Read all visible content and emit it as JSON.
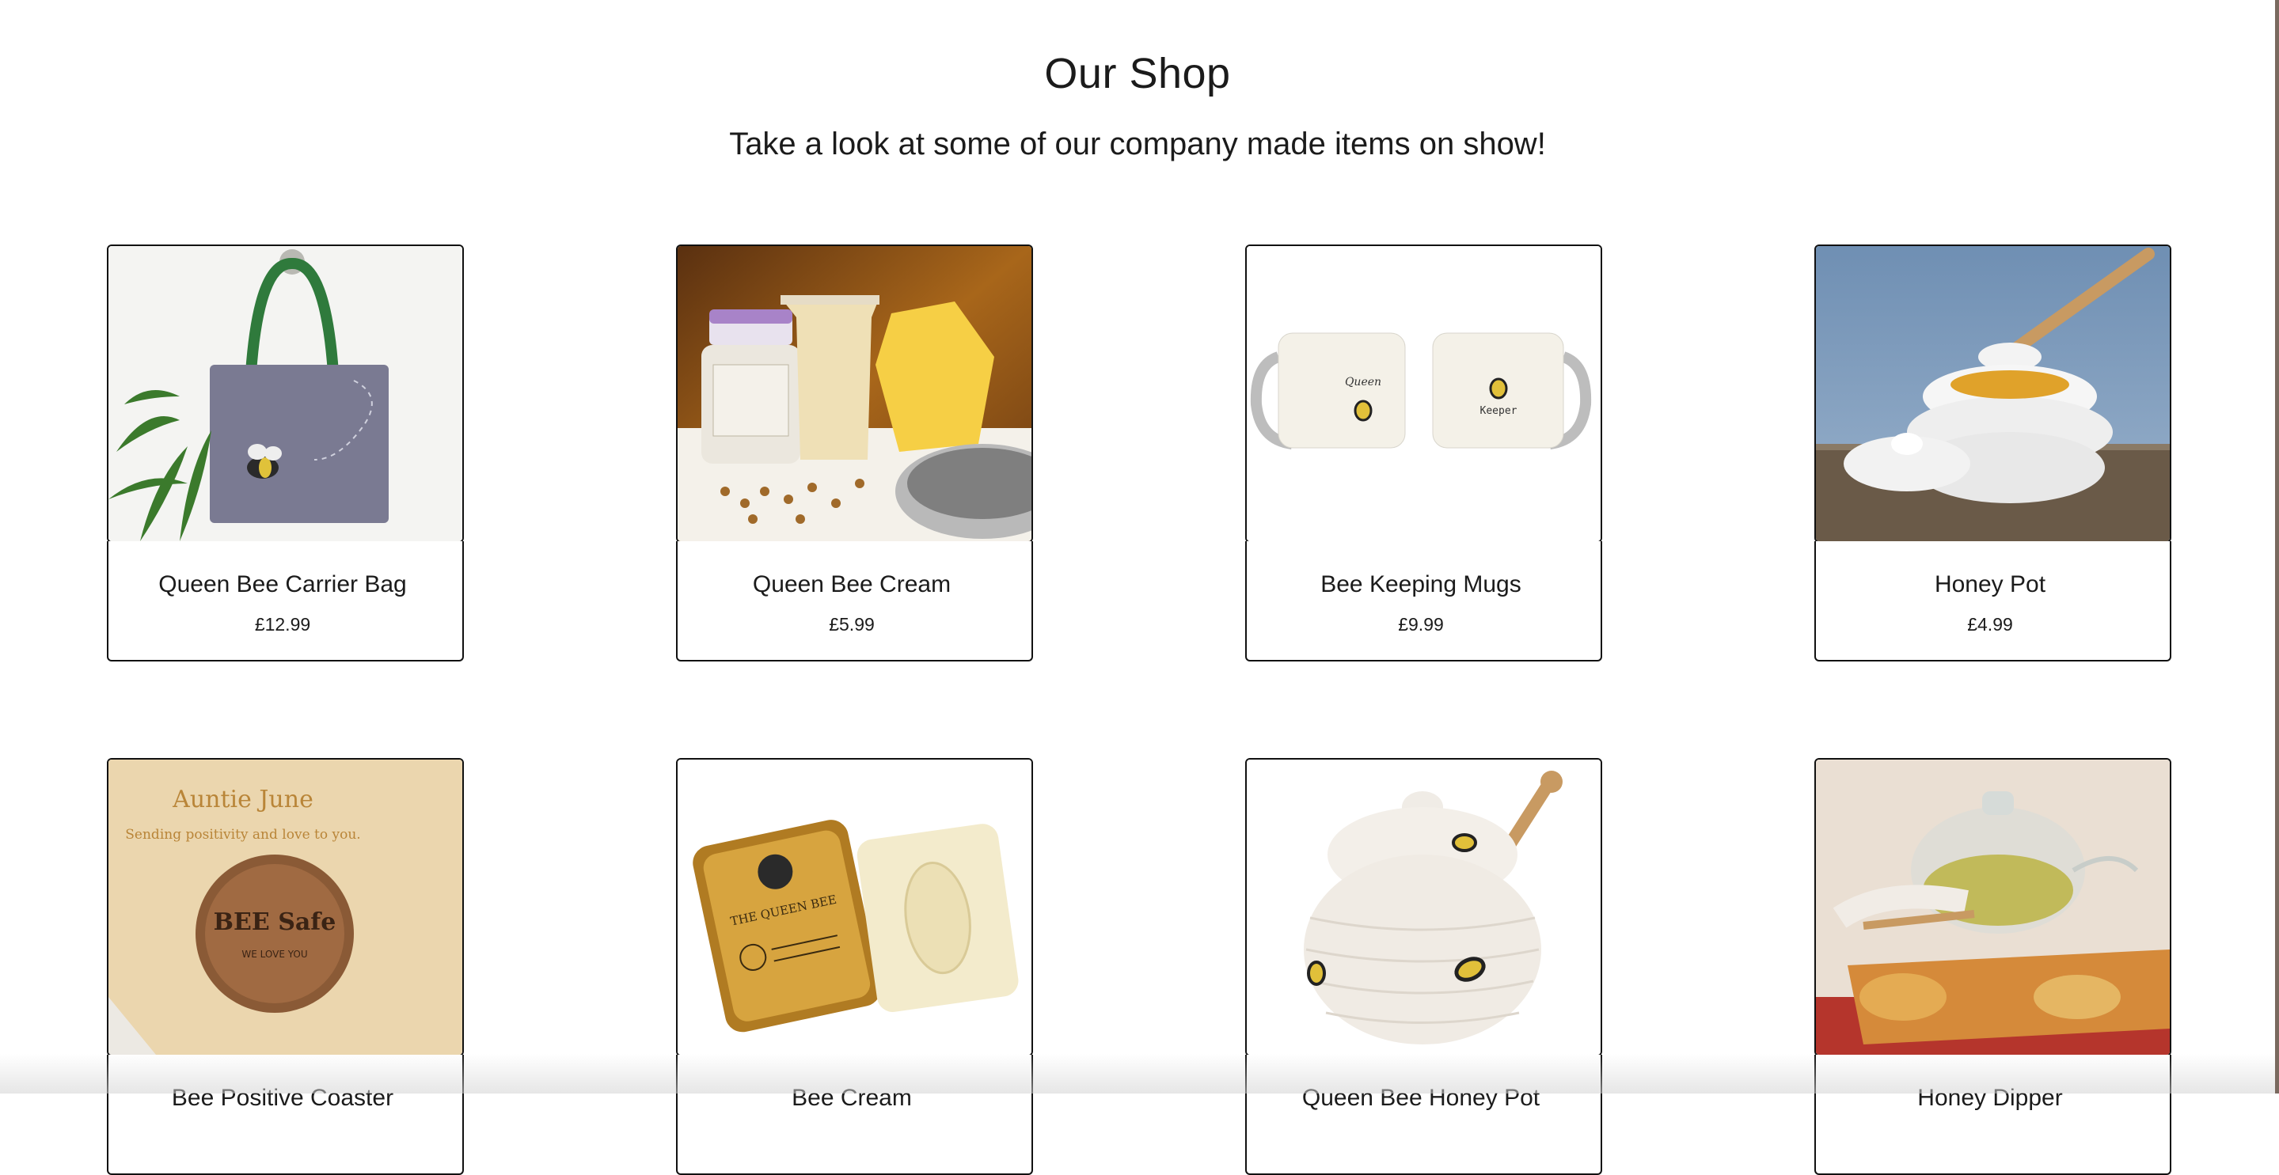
{
  "header": {
    "title": "Our Shop",
    "subtitle": "Take a look at some of our company made items on show!"
  },
  "products": [
    {
      "name": "Queen Bee Carrier Bag",
      "price": "£12.99",
      "image_icon": "tote-bag-image"
    },
    {
      "name": "Queen Bee Cream",
      "price": "£5.99",
      "image_icon": "cream-jar-image"
    },
    {
      "name": "Bee Keeping Mugs",
      "price": "£9.99",
      "image_icon": "mugs-image"
    },
    {
      "name": "Honey Pot",
      "price": "£4.99",
      "image_icon": "honey-pot-image"
    },
    {
      "name": "Bee Positive Coaster",
      "price": "",
      "image_icon": "coaster-image"
    },
    {
      "name": "Bee Cream",
      "price": "",
      "image_icon": "soap-tin-image"
    },
    {
      "name": "Queen Bee Honey Pot",
      "price": "",
      "image_icon": "ceramic-honey-pot-image"
    },
    {
      "name": "Honey Dipper",
      "price": "",
      "image_icon": "teapot-dipper-image"
    }
  ],
  "image_text": {
    "mug_left": "Queen",
    "mug_right": "Keeper",
    "coaster_card_heading": "Auntie June",
    "coaster_card_line": "Sending positivity and love to you.",
    "coaster_text": "BEE Safe",
    "coaster_sub": "WE LOVE YOU",
    "tin_text": "THE QUEEN BEE"
  },
  "colors": {
    "border": "#111111",
    "text": "#1b1b1b"
  }
}
